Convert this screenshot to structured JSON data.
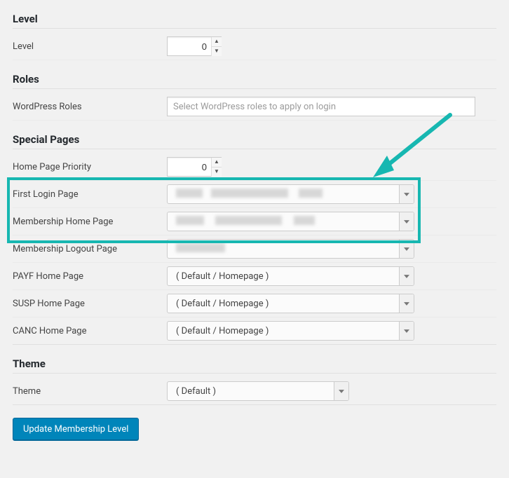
{
  "level": {
    "heading": "Level",
    "row_label": "Level",
    "value": "0"
  },
  "roles": {
    "heading": "Roles",
    "row_label": "WordPress Roles",
    "placeholder": "Select WordPress roles to apply on login"
  },
  "special_pages": {
    "heading": "Special Pages",
    "priority_label": "Home Page Priority",
    "priority_value": "0",
    "first_login_label": "First Login Page",
    "membership_home_label": "Membership Home Page",
    "membership_logout_label": "Membership Logout Page",
    "payf_label": "PAYF Home Page",
    "payf_value": "( Default / Homepage )",
    "susp_label": "SUSP Home Page",
    "susp_value": "( Default / Homepage )",
    "canc_label": "CANC Home Page",
    "canc_value": "( Default / Homepage )"
  },
  "theme": {
    "heading": "Theme",
    "row_label": "Theme",
    "value": "( Default )"
  },
  "button": {
    "submit": "Update Membership Level"
  },
  "accent": {
    "highlight": "#17b7b1"
  }
}
